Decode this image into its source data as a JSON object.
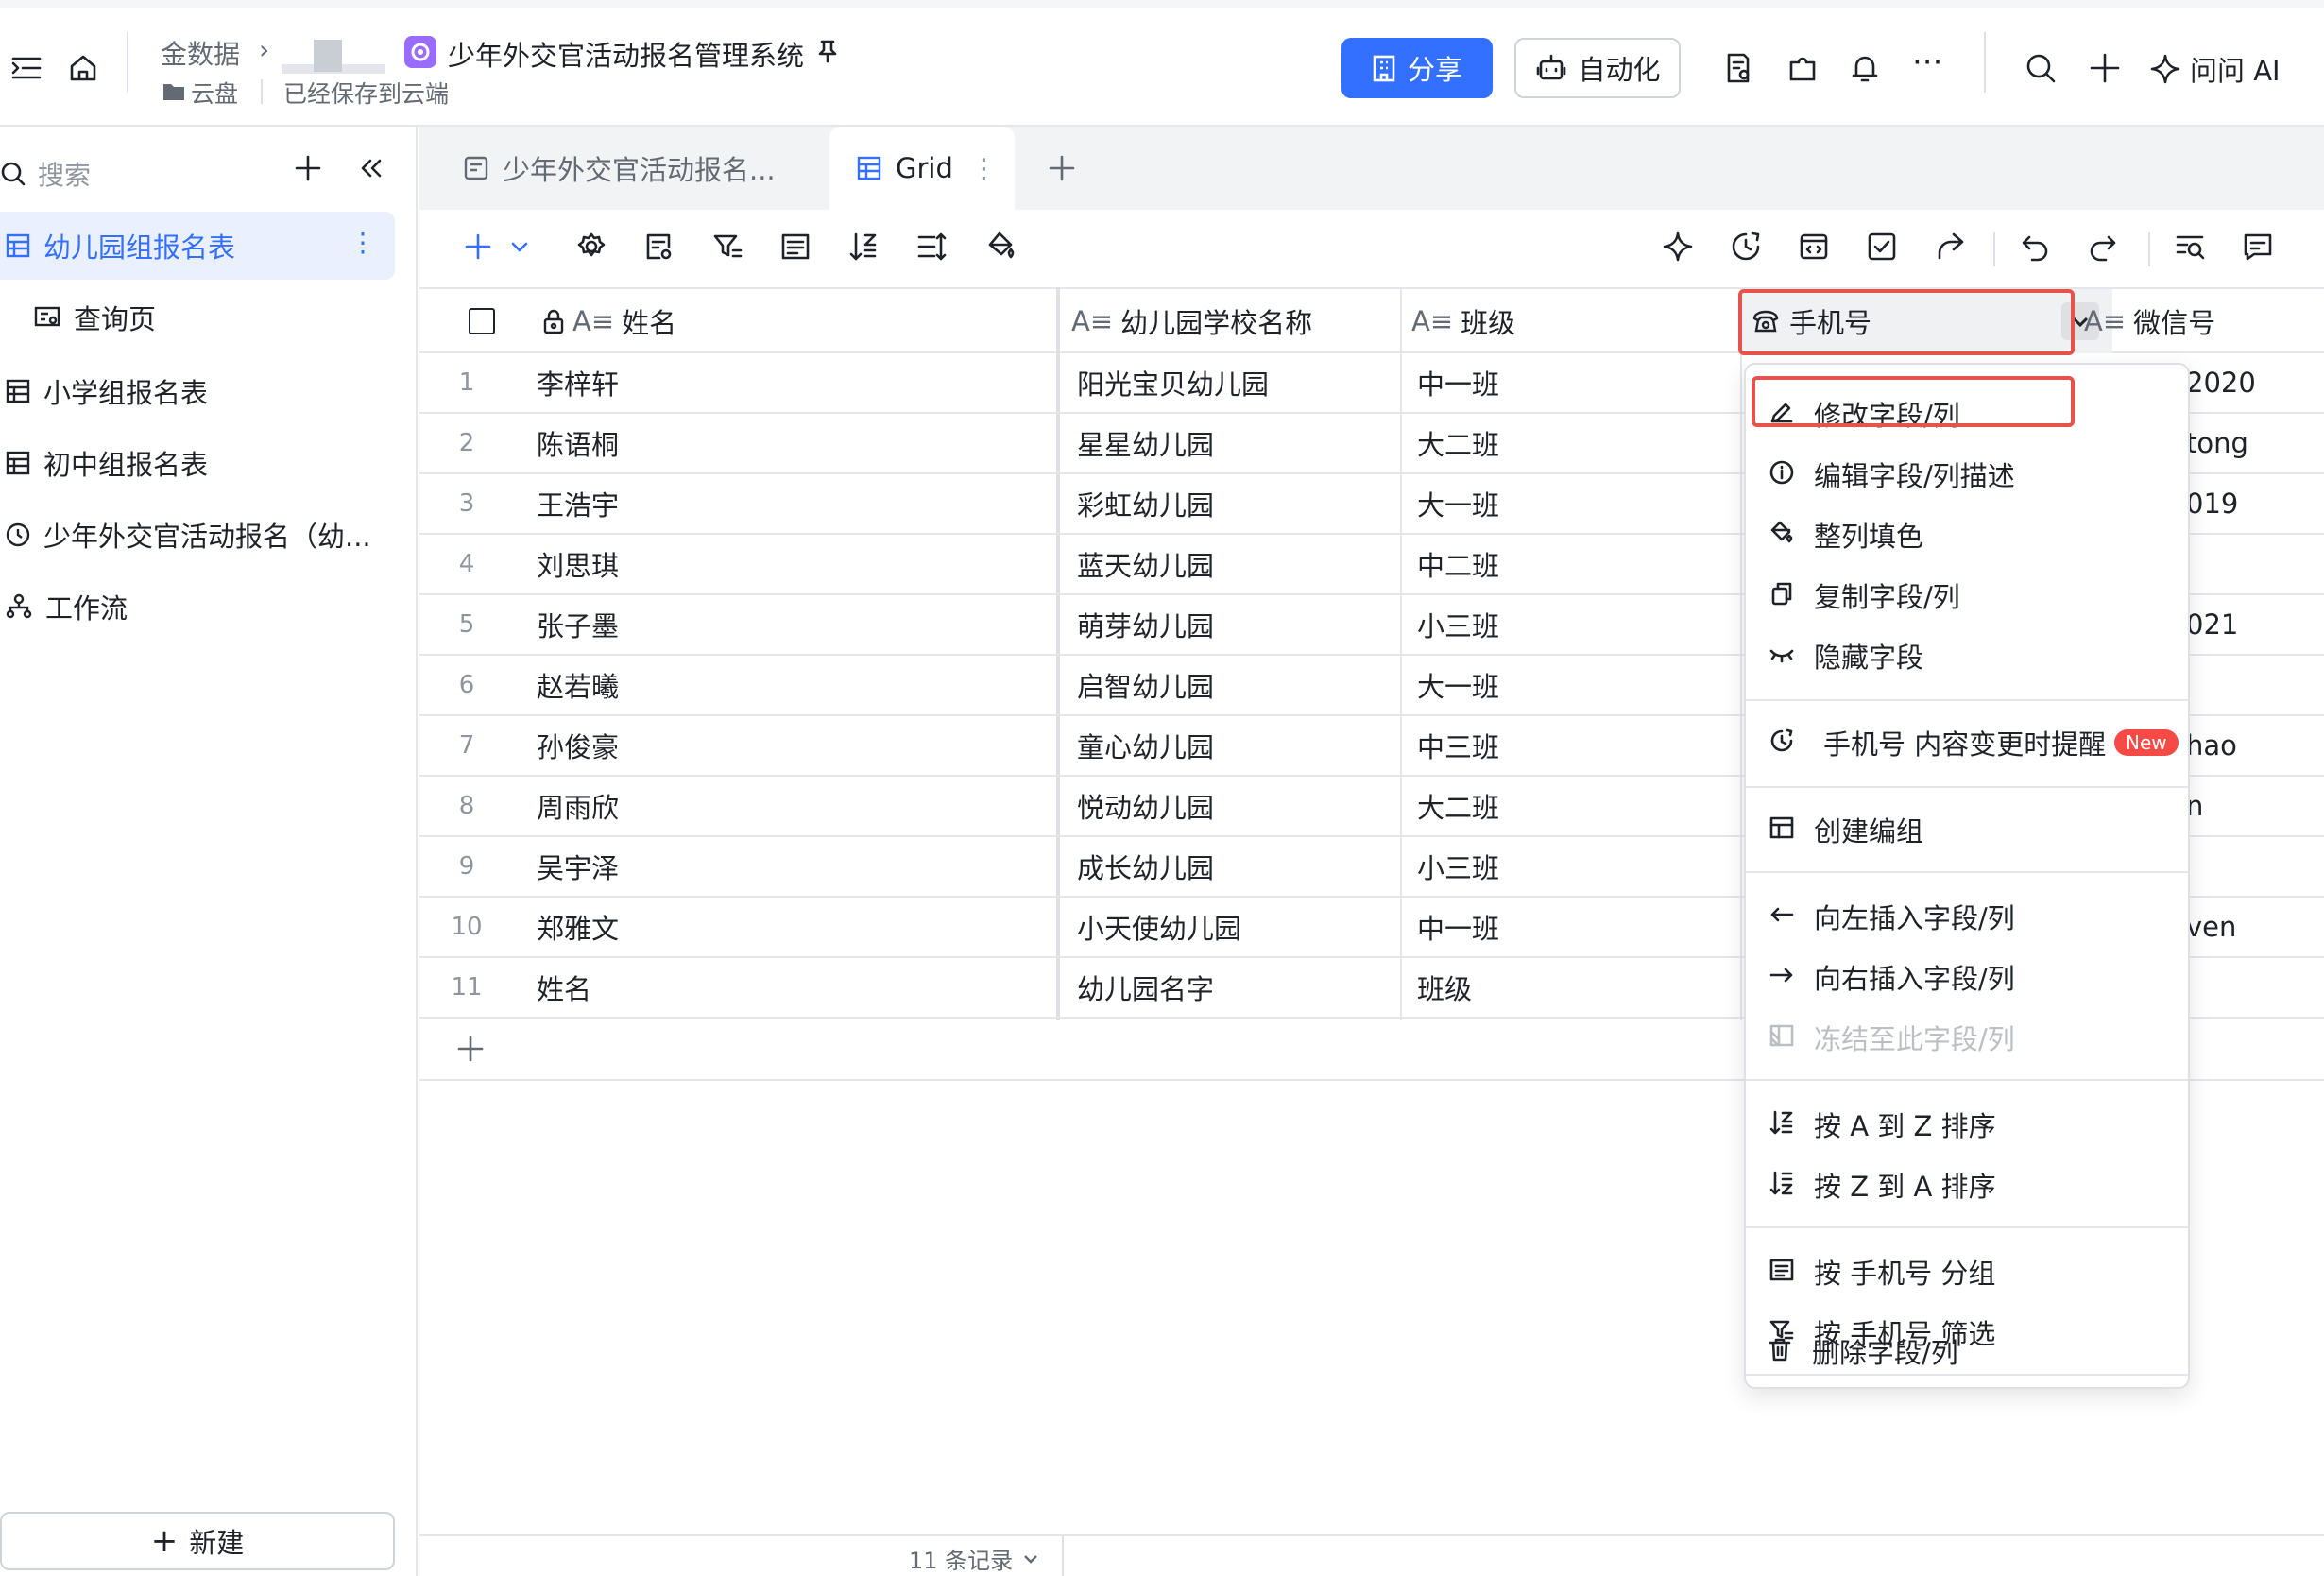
{
  "topbar": {
    "breadcrumb_root": "金数据",
    "app_title": "少年外交官活动报名管理系统",
    "folder": "云盘",
    "save_status": "已经保存到云端",
    "share_label": "分享",
    "automation_label": "自动化",
    "ask_ai_label": "问问 AI"
  },
  "sidebar": {
    "search_placeholder": "搜索",
    "items": [
      {
        "label": "幼儿园组报名表"
      },
      {
        "label": "查询页"
      },
      {
        "label": "小学组报名表"
      },
      {
        "label": "初中组报名表"
      },
      {
        "label": "少年外交官活动报名（幼..."
      },
      {
        "label": "工作流"
      }
    ],
    "new_label": "新建"
  },
  "tabs": [
    {
      "label": "少年外交官活动报名..."
    },
    {
      "label": "Grid"
    }
  ],
  "grid": {
    "columns": {
      "name": "姓名",
      "school": "幼儿园学校名称",
      "class": "班级",
      "phone": "手机号",
      "wechat": "微信号"
    },
    "rows": [
      {
        "idx": "1",
        "name": "李梓轩",
        "school": "阳光宝贝幼儿园",
        "class": "中一班",
        "wechat": "2020"
      },
      {
        "idx": "2",
        "name": "陈语桐",
        "school": "星星幼儿园",
        "class": "大二班",
        "wechat": "tong"
      },
      {
        "idx": "3",
        "name": "王浩宇",
        "school": "彩虹幼儿园",
        "class": "大一班",
        "wechat": "019"
      },
      {
        "idx": "4",
        "name": "刘思琪",
        "school": "蓝天幼儿园",
        "class": "中二班",
        "wechat": ""
      },
      {
        "idx": "5",
        "name": "张子墨",
        "school": "萌芽幼儿园",
        "class": "小三班",
        "wechat": "021"
      },
      {
        "idx": "6",
        "name": "赵若曦",
        "school": "启智幼儿园",
        "class": "大一班",
        "wechat": ""
      },
      {
        "idx": "7",
        "name": "孙俊豪",
        "school": "童心幼儿园",
        "class": "中三班",
        "wechat": "hao"
      },
      {
        "idx": "8",
        "name": "周雨欣",
        "school": "悦动幼儿园",
        "class": "大二班",
        "wechat": "n"
      },
      {
        "idx": "9",
        "name": "吴宇泽",
        "school": "成长幼儿园",
        "class": "小三班",
        "wechat": ""
      },
      {
        "idx": "10",
        "name": "郑雅文",
        "school": "小天使幼儿园",
        "class": "中一班",
        "wechat": "ven"
      },
      {
        "idx": "11",
        "name": "姓名",
        "school": "幼儿园名字",
        "class": "班级",
        "wechat": ""
      }
    ],
    "record_count": "11 条记录"
  },
  "menu": {
    "items": [
      {
        "label": "修改字段/列",
        "icon": "pencil-icon"
      },
      {
        "label": "编辑字段/列描述",
        "icon": "info-icon"
      },
      {
        "label": "整列填色",
        "icon": "paint-bucket-icon"
      },
      {
        "label": "复制字段/列",
        "icon": "copy-icon"
      },
      {
        "label": "隐藏字段",
        "icon": "eye-closed-icon"
      },
      {
        "label": "手机号 内容变更时提醒",
        "icon": "reminder-icon",
        "badge": "New"
      },
      {
        "label": "创建编组",
        "icon": "group-icon"
      },
      {
        "label": "向左插入字段/列",
        "icon": "arrow-left-icon"
      },
      {
        "label": "向右插入字段/列",
        "icon": "arrow-right-icon"
      },
      {
        "label": "冻结至此字段/列",
        "icon": "freeze-icon",
        "disabled": true
      },
      {
        "label": "按 A 到 Z 排序",
        "icon": "sort-asc-icon"
      },
      {
        "label": "按 Z 到 A 排序",
        "icon": "sort-desc-icon"
      },
      {
        "label": "按 手机号 分组",
        "icon": "group-by-icon"
      },
      {
        "label": "按 手机号 筛选",
        "icon": "filter-icon"
      },
      {
        "label": "删除字段/列",
        "icon": "trash-icon"
      }
    ]
  },
  "colors": {
    "accent": "#3370ff",
    "highlight": "#e5534b",
    "badge": "#f54a45"
  }
}
